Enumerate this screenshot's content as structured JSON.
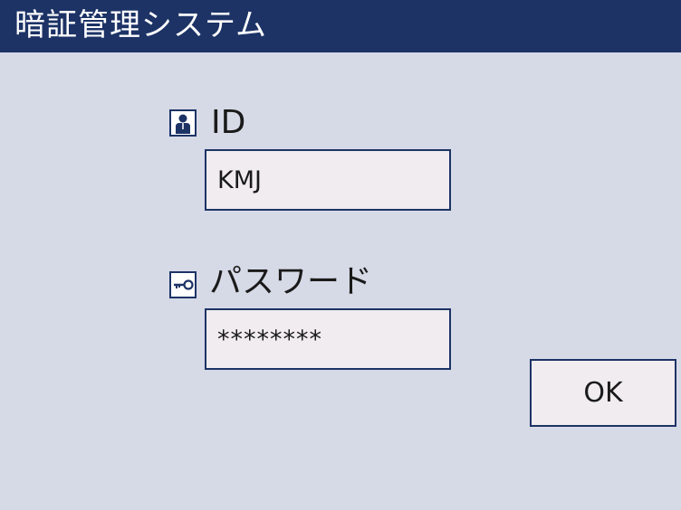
{
  "header": {
    "title": "暗証管理システム",
    "background_color": "#1d3366",
    "text_color": "#ffffff"
  },
  "form": {
    "id_field": {
      "icon": "user-icon",
      "label": "ID",
      "value": "KMJ"
    },
    "password_field": {
      "icon": "key-icon",
      "label": "パスワード",
      "value": "********"
    },
    "ok_button": {
      "label": "OK"
    }
  },
  "colors": {
    "background": "#d6d9e6",
    "field_background": "#f0ecef",
    "border": "#1d3366"
  }
}
